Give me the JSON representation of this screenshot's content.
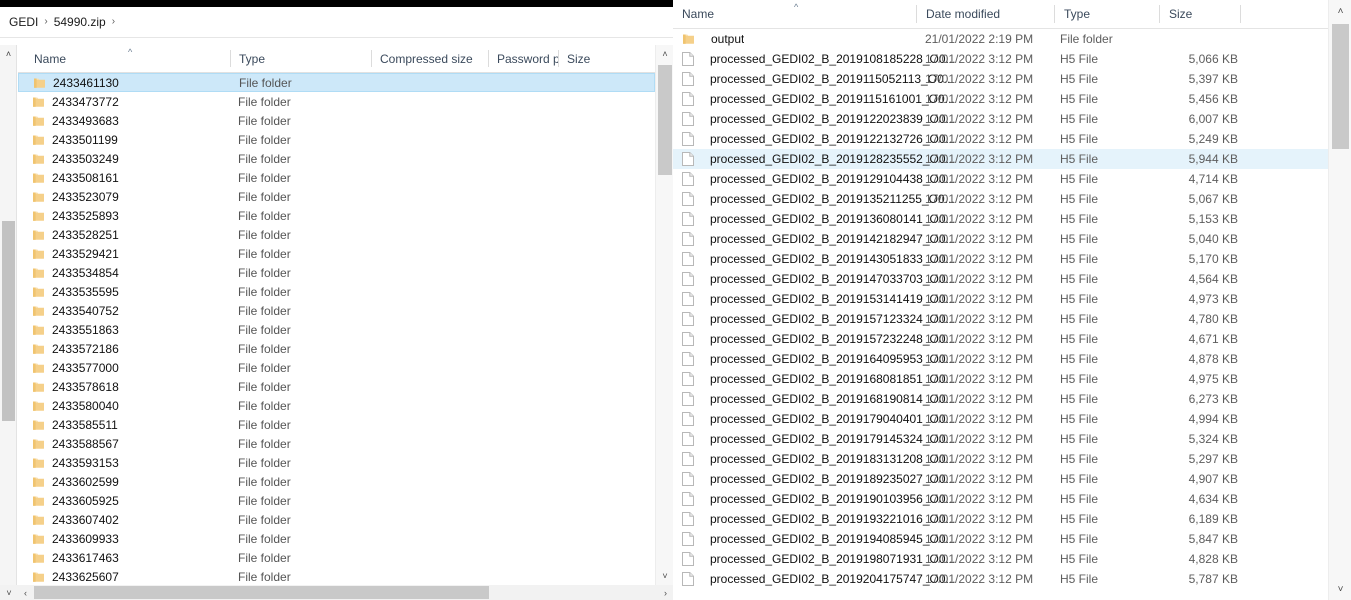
{
  "left_window": {
    "breadcrumb": {
      "items": [
        "GEDI",
        "54990.zip"
      ],
      "separator": "›"
    },
    "columns": [
      {
        "key": "name",
        "label": "Name",
        "sorted": true,
        "sort_dir": "asc"
      },
      {
        "key": "type",
        "label": "Type"
      },
      {
        "key": "compressed_size",
        "label": "Compressed size"
      },
      {
        "key": "password_protected",
        "label": "Password p..."
      },
      {
        "key": "size",
        "label": "Size"
      }
    ],
    "rows": [
      {
        "name": "2433461130",
        "type": "File folder",
        "icon": "folder-icon",
        "selected": true
      },
      {
        "name": "2433473772",
        "type": "File folder",
        "icon": "folder-icon",
        "selected": false
      },
      {
        "name": "2433493683",
        "type": "File folder",
        "icon": "folder-icon",
        "selected": false
      },
      {
        "name": "2433501199",
        "type": "File folder",
        "icon": "folder-icon",
        "selected": false
      },
      {
        "name": "2433503249",
        "type": "File folder",
        "icon": "folder-icon",
        "selected": false
      },
      {
        "name": "2433508161",
        "type": "File folder",
        "icon": "folder-icon",
        "selected": false
      },
      {
        "name": "2433523079",
        "type": "File folder",
        "icon": "folder-icon",
        "selected": false
      },
      {
        "name": "2433525893",
        "type": "File folder",
        "icon": "folder-icon",
        "selected": false
      },
      {
        "name": "2433528251",
        "type": "File folder",
        "icon": "folder-icon",
        "selected": false
      },
      {
        "name": "2433529421",
        "type": "File folder",
        "icon": "folder-icon",
        "selected": false
      },
      {
        "name": "2433534854",
        "type": "File folder",
        "icon": "folder-icon",
        "selected": false
      },
      {
        "name": "2433535595",
        "type": "File folder",
        "icon": "folder-icon",
        "selected": false
      },
      {
        "name": "2433540752",
        "type": "File folder",
        "icon": "folder-icon",
        "selected": false
      },
      {
        "name": "2433551863",
        "type": "File folder",
        "icon": "folder-icon",
        "selected": false
      },
      {
        "name": "2433572186",
        "type": "File folder",
        "icon": "folder-icon",
        "selected": false
      },
      {
        "name": "2433577000",
        "type": "File folder",
        "icon": "folder-icon",
        "selected": false
      },
      {
        "name": "2433578618",
        "type": "File folder",
        "icon": "folder-icon",
        "selected": false
      },
      {
        "name": "2433580040",
        "type": "File folder",
        "icon": "folder-icon",
        "selected": false
      },
      {
        "name": "2433585511",
        "type": "File folder",
        "icon": "folder-icon",
        "selected": false
      },
      {
        "name": "2433588567",
        "type": "File folder",
        "icon": "folder-icon",
        "selected": false
      },
      {
        "name": "2433593153",
        "type": "File folder",
        "icon": "folder-icon",
        "selected": false
      },
      {
        "name": "2433602599",
        "type": "File folder",
        "icon": "folder-icon",
        "selected": false
      },
      {
        "name": "2433605925",
        "type": "File folder",
        "icon": "folder-icon",
        "selected": false
      },
      {
        "name": "2433607402",
        "type": "File folder",
        "icon": "folder-icon",
        "selected": false
      },
      {
        "name": "2433609933",
        "type": "File folder",
        "icon": "folder-icon",
        "selected": false
      },
      {
        "name": "2433617463",
        "type": "File folder",
        "icon": "folder-icon",
        "selected": false
      },
      {
        "name": "2433625607",
        "type": "File folder",
        "icon": "folder-icon",
        "selected": false
      }
    ],
    "scrollbars": {
      "nav_up_arrow": "˄",
      "nav_down_arrow": "˅",
      "vertical_up_arrow": "˄",
      "vertical_down_arrow": "˅",
      "horizontal_left_arrow": "‹",
      "horizontal_right_arrow": "›"
    }
  },
  "right_window": {
    "columns": [
      {
        "key": "name",
        "label": "Name",
        "sorted": true,
        "sort_dir": "asc"
      },
      {
        "key": "date_modified",
        "label": "Date modified"
      },
      {
        "key": "type",
        "label": "Type"
      },
      {
        "key": "size",
        "label": "Size"
      }
    ],
    "rows": [
      {
        "name": "output",
        "date": "21/01/2022 2:19 PM",
        "type": "File folder",
        "size": "",
        "icon": "folder-icon",
        "selected": false
      },
      {
        "name": "processed_GEDI02_B_2019108185228_O0...",
        "date": "17/01/2022 3:12 PM",
        "type": "H5 File",
        "size": "5,066 KB",
        "icon": "file-icon",
        "selected": false
      },
      {
        "name": "processed_GEDI02_B_2019115052113_O0...",
        "date": "17/01/2022 3:12 PM",
        "type": "H5 File",
        "size": "5,397 KB",
        "icon": "file-icon",
        "selected": false
      },
      {
        "name": "processed_GEDI02_B_2019115161001_O0...",
        "date": "17/01/2022 3:12 PM",
        "type": "H5 File",
        "size": "5,456 KB",
        "icon": "file-icon",
        "selected": false
      },
      {
        "name": "processed_GEDI02_B_2019122023839_O0...",
        "date": "17/01/2022 3:12 PM",
        "type": "H5 File",
        "size": "6,007 KB",
        "icon": "file-icon",
        "selected": false
      },
      {
        "name": "processed_GEDI02_B_2019122132726_O0...",
        "date": "17/01/2022 3:12 PM",
        "type": "H5 File",
        "size": "5,249 KB",
        "icon": "file-icon",
        "selected": false
      },
      {
        "name": "processed_GEDI02_B_2019128235552_O0...",
        "date": "17/01/2022 3:12 PM",
        "type": "H5 File",
        "size": "5,944 KB",
        "icon": "file-icon",
        "selected": true
      },
      {
        "name": "processed_GEDI02_B_2019129104438_O0...",
        "date": "17/01/2022 3:12 PM",
        "type": "H5 File",
        "size": "4,714 KB",
        "icon": "file-icon",
        "selected": false
      },
      {
        "name": "processed_GEDI02_B_2019135211255_O0...",
        "date": "17/01/2022 3:12 PM",
        "type": "H5 File",
        "size": "5,067 KB",
        "icon": "file-icon",
        "selected": false
      },
      {
        "name": "processed_GEDI02_B_2019136080141_O0...",
        "date": "17/01/2022 3:12 PM",
        "type": "H5 File",
        "size": "5,153 KB",
        "icon": "file-icon",
        "selected": false
      },
      {
        "name": "processed_GEDI02_B_2019142182947_O0...",
        "date": "17/01/2022 3:12 PM",
        "type": "H5 File",
        "size": "5,040 KB",
        "icon": "file-icon",
        "selected": false
      },
      {
        "name": "processed_GEDI02_B_2019143051833_O0...",
        "date": "17/01/2022 3:12 PM",
        "type": "H5 File",
        "size": "5,170 KB",
        "icon": "file-icon",
        "selected": false
      },
      {
        "name": "processed_GEDI02_B_2019147033703_O0...",
        "date": "17/01/2022 3:12 PM",
        "type": "H5 File",
        "size": "4,564 KB",
        "icon": "file-icon",
        "selected": false
      },
      {
        "name": "processed_GEDI02_B_2019153141419_O0...",
        "date": "17/01/2022 3:12 PM",
        "type": "H5 File",
        "size": "4,973 KB",
        "icon": "file-icon",
        "selected": false
      },
      {
        "name": "processed_GEDI02_B_2019157123324_O0...",
        "date": "17/01/2022 3:12 PM",
        "type": "H5 File",
        "size": "4,780 KB",
        "icon": "file-icon",
        "selected": false
      },
      {
        "name": "processed_GEDI02_B_2019157232248_O0...",
        "date": "17/01/2022 3:12 PM",
        "type": "H5 File",
        "size": "4,671 KB",
        "icon": "file-icon",
        "selected": false
      },
      {
        "name": "processed_GEDI02_B_2019164095953_O0...",
        "date": "17/01/2022 3:12 PM",
        "type": "H5 File",
        "size": "4,878 KB",
        "icon": "file-icon",
        "selected": false
      },
      {
        "name": "processed_GEDI02_B_2019168081851_O0...",
        "date": "17/01/2022 3:12 PM",
        "type": "H5 File",
        "size": "4,975 KB",
        "icon": "file-icon",
        "selected": false
      },
      {
        "name": "processed_GEDI02_B_2019168190814_O0...",
        "date": "17/01/2022 3:12 PM",
        "type": "H5 File",
        "size": "6,273 KB",
        "icon": "file-icon",
        "selected": false
      },
      {
        "name": "processed_GEDI02_B_2019179040401_O0...",
        "date": "17/01/2022 3:12 PM",
        "type": "H5 File",
        "size": "4,994 KB",
        "icon": "file-icon",
        "selected": false
      },
      {
        "name": "processed_GEDI02_B_2019179145324_O0...",
        "date": "17/01/2022 3:12 PM",
        "type": "H5 File",
        "size": "5,324 KB",
        "icon": "file-icon",
        "selected": false
      },
      {
        "name": "processed_GEDI02_B_2019183131208_O0...",
        "date": "17/01/2022 3:12 PM",
        "type": "H5 File",
        "size": "5,297 KB",
        "icon": "file-icon",
        "selected": false
      },
      {
        "name": "processed_GEDI02_B_2019189235027_O0...",
        "date": "17/01/2022 3:12 PM",
        "type": "H5 File",
        "size": "4,907 KB",
        "icon": "file-icon",
        "selected": false
      },
      {
        "name": "processed_GEDI02_B_2019190103956_O0...",
        "date": "17/01/2022 3:12 PM",
        "type": "H5 File",
        "size": "4,634 KB",
        "icon": "file-icon",
        "selected": false
      },
      {
        "name": "processed_GEDI02_B_2019193221016_O0...",
        "date": "17/01/2022 3:12 PM",
        "type": "H5 File",
        "size": "6,189 KB",
        "icon": "file-icon",
        "selected": false
      },
      {
        "name": "processed_GEDI02_B_2019194085945_O0...",
        "date": "17/01/2022 3:12 PM",
        "type": "H5 File",
        "size": "5,847 KB",
        "icon": "file-icon",
        "selected": false
      },
      {
        "name": "processed_GEDI02_B_2019198071931_O0...",
        "date": "17/01/2022 3:12 PM",
        "type": "H5 File",
        "size": "4,828 KB",
        "icon": "file-icon",
        "selected": false
      },
      {
        "name": "processed_GEDI02_B_2019204175747_O0...",
        "date": "17/01/2022 3:12 PM",
        "type": "H5 File",
        "size": "5,787 KB",
        "icon": "file-icon",
        "selected": false
      }
    ],
    "scrollbars": {
      "vertical_up_arrow": "˄",
      "vertical_down_arrow": "˅"
    }
  },
  "colors": {
    "selection_strong": "#cde8f9",
    "selection_soft": "#e5f3fb",
    "header_text": "#3b4a5c",
    "folder_icon": "#f7d486",
    "scrollbar_thumb": "#c9c9c9"
  }
}
